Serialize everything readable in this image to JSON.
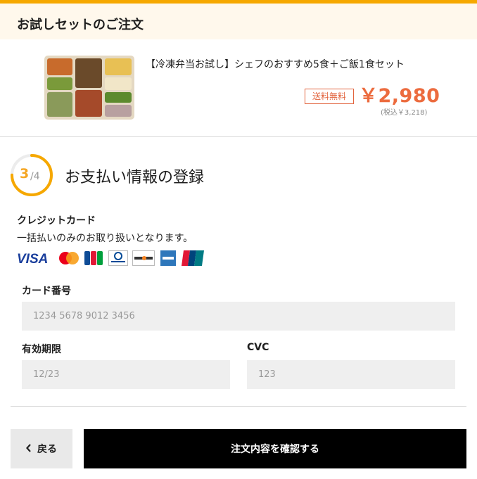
{
  "header": {
    "title": "お試しセットのご注文"
  },
  "product": {
    "name": "【冷凍弁当お試し】シェフのおすすめ5食＋ご飯1食セット",
    "free_shipping": "送料無料",
    "price": "￥2,980",
    "tax_included": "(税込￥3,218)"
  },
  "step": {
    "current": "3",
    "total": "/4",
    "progress": 0.75,
    "title": "お支払い情報の登録"
  },
  "credit_card": {
    "heading": "クレジットカード",
    "note": "一括払いのみのお取り扱いとなります。",
    "brands": [
      "VISA",
      "Mastercard",
      "JCB",
      "Diners Club",
      "DISCOVER",
      "AMERICAN EXPRESS",
      "UnionPay 銀聯"
    ]
  },
  "form": {
    "card_number": {
      "label": "カード番号",
      "placeholder": "1234 5678 9012 3456"
    },
    "expiry": {
      "label": "有効期限",
      "placeholder": "12/23"
    },
    "cvc": {
      "label": "CVC",
      "placeholder": "123"
    }
  },
  "actions": {
    "back_label": "戻る",
    "confirm_label": "注文内容を確認する"
  },
  "colors": {
    "accent": "#f6a800",
    "price": "#ec6b3e",
    "header_bg": "#fff8ec",
    "button_primary": "#000000"
  }
}
